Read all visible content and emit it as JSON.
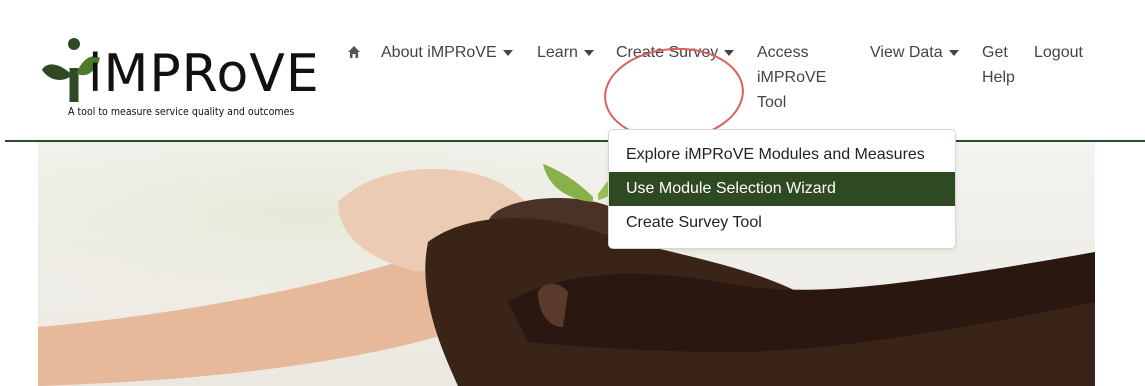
{
  "brand": {
    "name": "iMPRoVE",
    "tagline": "A tool to measure service quality and outcomes",
    "colors": {
      "accent_dark_green": "#2f4a22",
      "leaf_green": "#4a7a2a",
      "annotation_red": "#d9605b"
    }
  },
  "nav": {
    "home_icon": "home-icon",
    "items": [
      {
        "label": "About iMPRoVE",
        "dropdown": true
      },
      {
        "label": "Learn",
        "dropdown": true
      },
      {
        "label": "Create Survey",
        "dropdown": true,
        "open": true
      },
      {
        "label_lines": [
          "Access",
          "iMPRoVE",
          "Tool"
        ],
        "dropdown": false
      },
      {
        "label": "View Data",
        "dropdown": true
      },
      {
        "label_lines": [
          "Get",
          "Help"
        ],
        "dropdown": false
      },
      {
        "label": "Logout",
        "dropdown": false
      }
    ]
  },
  "dropdown": {
    "items": [
      {
        "label": "Explore iMPRoVE Modules and Measures",
        "active": false
      },
      {
        "label": "Use Module Selection Wizard",
        "active": true
      },
      {
        "label": "Create Survey Tool",
        "active": false
      }
    ]
  }
}
